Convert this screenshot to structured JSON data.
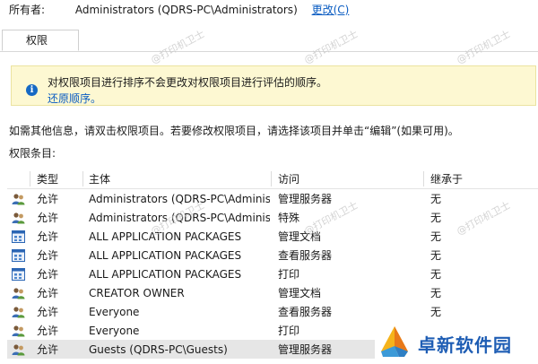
{
  "owner": {
    "label": "所有者:",
    "value": "Administrators (QDRS-PC\\Administrators)",
    "change_link": "更改(C)"
  },
  "tabs": [
    {
      "label": "权限"
    }
  ],
  "info_banner": {
    "text": "对权限项目进行排序不会更改对权限项目进行评估的顺序。",
    "link": "还原顺序。"
  },
  "hint": "如需其他信息，请双击权限项目。若要修改权限项目，请选择该项目并单击“编辑”(如果可用)。",
  "entries_label": "权限条目:",
  "table": {
    "headers": {
      "type": "类型",
      "principal": "主体",
      "access": "访问",
      "inherited": "继承于"
    },
    "rows": [
      {
        "icon": "user-group-icon",
        "type": "允许",
        "principal": "Administrators (QDRS-PC\\Administrators)",
        "access": "管理服务器",
        "inherited": "无"
      },
      {
        "icon": "user-group-icon",
        "type": "允许",
        "principal": "Administrators (QDRS-PC\\Administrators)",
        "access": "特殊",
        "inherited": "无"
      },
      {
        "icon": "app-package-icon",
        "type": "允许",
        "principal": "ALL APPLICATION PACKAGES",
        "access": "管理文档",
        "inherited": "无"
      },
      {
        "icon": "app-package-icon",
        "type": "允许",
        "principal": "ALL APPLICATION PACKAGES",
        "access": "查看服务器",
        "inherited": "无"
      },
      {
        "icon": "app-package-icon",
        "type": "允许",
        "principal": "ALL APPLICATION PACKAGES",
        "access": "打印",
        "inherited": "无"
      },
      {
        "icon": "user-group-icon",
        "type": "允许",
        "principal": "CREATOR OWNER",
        "access": "管理文档",
        "inherited": "无"
      },
      {
        "icon": "user-group-icon",
        "type": "允许",
        "principal": "Everyone",
        "access": "查看服务器",
        "inherited": "无"
      },
      {
        "icon": "user-group-icon",
        "type": "允许",
        "principal": "Everyone",
        "access": "打印",
        "inherited": ""
      },
      {
        "icon": "user-group-icon",
        "type": "允许",
        "principal": "Guests (QDRS-PC\\Guests)",
        "access": "管理服务器",
        "inherited": ""
      }
    ]
  },
  "watermark": "@打印机卫士",
  "brand": {
    "text": "卓新软件园"
  },
  "colors": {
    "link": "#0a5cc2",
    "info_bg": "#fdf8d2",
    "brand": "#1e5db4"
  }
}
